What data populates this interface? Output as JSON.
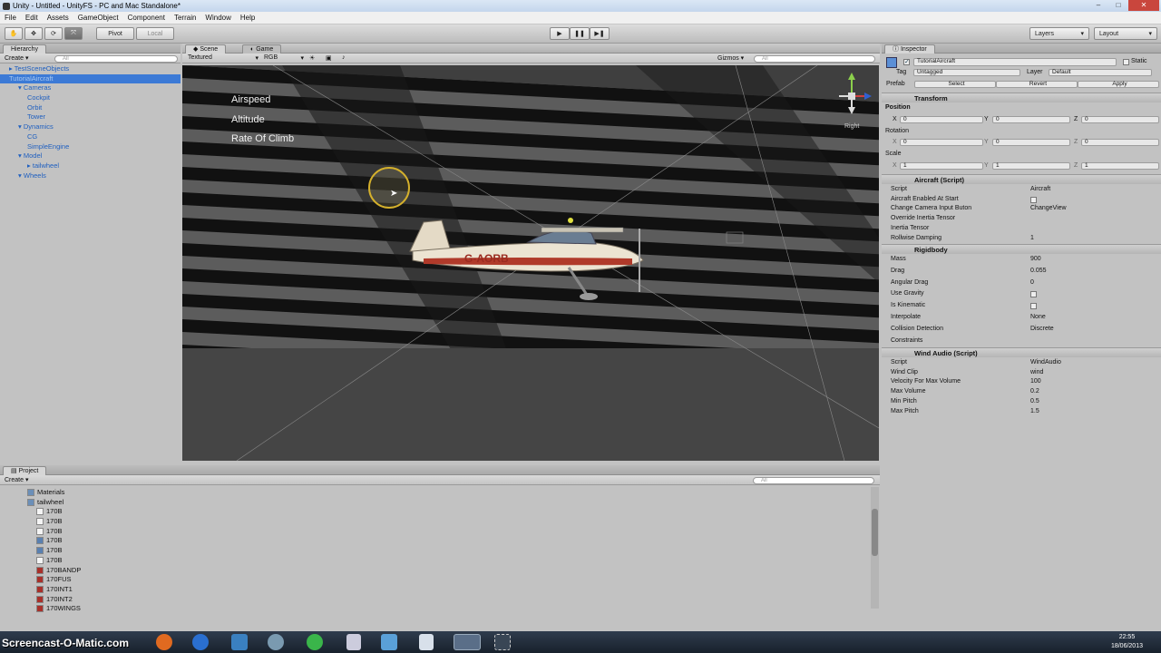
{
  "window": {
    "title": "Unity - Untitled - UnityFS - PC and Mac Standalone*"
  },
  "menu": [
    "File",
    "Edit",
    "Assets",
    "GameObject",
    "Component",
    "Terrain",
    "Window",
    "Help"
  ],
  "toolbar": {
    "pivot": "Pivot",
    "local": "Local",
    "layers": "Layers",
    "layout": "Layout"
  },
  "hierarchy": {
    "tab": "Hierarchy",
    "create": "Create",
    "search_placeholder": "All",
    "items": [
      {
        "label": "TestSceneObjects",
        "indent": 0
      },
      {
        "label": "TutorialAircraft",
        "indent": 0,
        "selected": true
      },
      {
        "label": "Cameras",
        "indent": 1
      },
      {
        "label": "Cockpit",
        "indent": 2
      },
      {
        "label": "Orbit",
        "indent": 2
      },
      {
        "label": "Tower",
        "indent": 2
      },
      {
        "label": "Dynamics",
        "indent": 1
      },
      {
        "label": "CG",
        "indent": 2
      },
      {
        "label": "SimpleEngine",
        "indent": 2
      },
      {
        "label": "Model",
        "indent": 1
      },
      {
        "label": "tailwheel",
        "indent": 2
      },
      {
        "label": "Wheels",
        "indent": 1
      }
    ]
  },
  "scene": {
    "tabs": [
      "Scene",
      "Game"
    ],
    "render_mode": "Textured",
    "color_mode": "RGB",
    "gizmos": "Gizmos",
    "search_placeholder": "All",
    "hud": [
      "Airspeed",
      "Altitude",
      "Rate Of Climb"
    ],
    "gizmo_label": "Right",
    "registration": "G-AORB"
  },
  "inspector": {
    "tab": "Inspector",
    "object_name": "TutorialAircraft",
    "static": "Static",
    "tag_label": "Tag",
    "tag_value": "Untagged",
    "layer_label": "Layer",
    "layer_value": "Default",
    "prefab": "Prefab",
    "select": "Select",
    "revert": "Revert",
    "apply": "Apply",
    "transform": {
      "title": "Transform",
      "position": "Position",
      "rotation": "Rotation",
      "scale": "Scale",
      "pos": [
        "0",
        "0",
        "0"
      ],
      "rot": [
        "0",
        "0",
        "0"
      ],
      "scl": [
        "1",
        "1",
        "1"
      ],
      "x": "X",
      "y": "Y",
      "z": "Z"
    },
    "aircraft": {
      "title": "Aircraft (Script)",
      "rows": [
        {
          "label": "Script",
          "value": "Aircraft"
        },
        {
          "label": "Aircraft Enabled At Start",
          "value": ""
        },
        {
          "label": "Change Camera Input Buton",
          "value": "ChangeView"
        },
        {
          "label": "Override Inertia Tensor",
          "value": ""
        },
        {
          "label": "Inertia Tensor",
          "value": ""
        },
        {
          "label": "Rollwise Damping",
          "value": "1"
        }
      ]
    },
    "rigidbody": {
      "title": "Rigidbody",
      "rows": [
        {
          "label": "Mass",
          "value": "900"
        },
        {
          "label": "Drag",
          "value": "0.055"
        },
        {
          "label": "Angular Drag",
          "value": "0"
        },
        {
          "label": "Use Gravity",
          "value": ""
        },
        {
          "label": "Is Kinematic",
          "value": ""
        },
        {
          "label": "Interpolate",
          "value": "None"
        },
        {
          "label": "Collision Detection",
          "value": "Discrete"
        },
        {
          "label": "Constraints",
          "value": ""
        }
      ]
    },
    "wind": {
      "title": "Wind Audio (Script)",
      "rows": [
        {
          "label": "Script",
          "value": "WindAudio"
        },
        {
          "label": "Wind Clip",
          "value": "wind"
        },
        {
          "label": "Velocity For Max Volume",
          "value": "100"
        },
        {
          "label": "Max Volume",
          "value": "0.2"
        },
        {
          "label": "Min Pitch",
          "value": "0.5"
        },
        {
          "label": "Max Pitch",
          "value": "1.5"
        }
      ]
    }
  },
  "project": {
    "tab": "Project",
    "create": "Create",
    "search_placeholder": "All",
    "items": [
      {
        "label": "Materials",
        "indent": 1,
        "icon": "folder"
      },
      {
        "label": "tailwheel",
        "indent": 1,
        "icon": "folder"
      },
      {
        "label": "170B",
        "indent": 2,
        "icon": "file"
      },
      {
        "label": "170B",
        "indent": 2,
        "icon": "file"
      },
      {
        "label": "170B",
        "indent": 2,
        "icon": "file"
      },
      {
        "label": "170B",
        "indent": 2,
        "icon": "mesh"
      },
      {
        "label": "170B",
        "indent": 2,
        "icon": "mesh"
      },
      {
        "label": "170B",
        "indent": 2,
        "icon": "file"
      },
      {
        "label": "170BANDP",
        "indent": 2,
        "icon": "texture"
      },
      {
        "label": "170FUS",
        "indent": 2,
        "icon": "texture"
      },
      {
        "label": "170INT1",
        "indent": 2,
        "icon": "texture"
      },
      {
        "label": "170INT2",
        "indent": 2,
        "icon": "texture"
      },
      {
        "label": "170WINGS",
        "indent": 2,
        "icon": "texture"
      }
    ]
  },
  "taskbar": {
    "time": "22:55",
    "date": "18/06/2013",
    "watermark": "Screencast-O-Matic.com"
  }
}
